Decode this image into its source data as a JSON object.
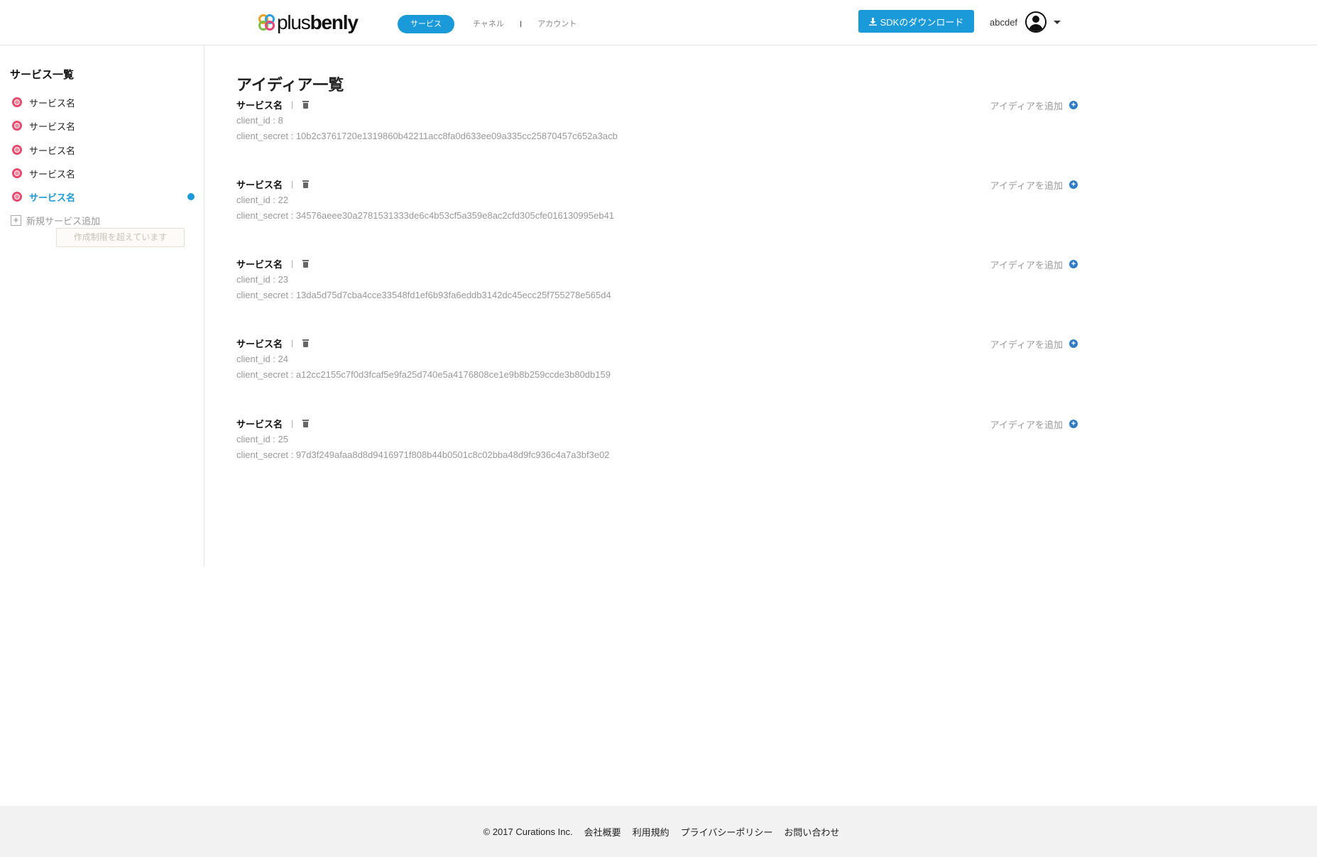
{
  "header": {
    "logo": {
      "light": "plus",
      "bold": "benly"
    },
    "nav": {
      "active": "サービス",
      "items": [
        "チャネル",
        "アカウント"
      ],
      "separator": "I"
    },
    "sdk_button": "SDKのダウンロード",
    "user_name": "abcdef"
  },
  "sidebar": {
    "title": "サービス一覧",
    "items": [
      {
        "label": "サービス名"
      },
      {
        "label": "サービス名"
      },
      {
        "label": "サービス名"
      },
      {
        "label": "サービス名"
      },
      {
        "label": "サービス名"
      }
    ],
    "add_label": "新規サービス追加",
    "limit_notice": "作成制限を超えています"
  },
  "main": {
    "title": "アイディア一覧",
    "add_idea_label": "アイディアを追加",
    "pipe": "|",
    "entries": [
      {
        "name": "サービス名",
        "client_id": "client_id : 8",
        "client_secret": "client_secret : 10b2c3761720e1319860b42211acc8fa0d633ee09a335cc25870457c652a3acb"
      },
      {
        "name": "サービス名",
        "client_id": "client_id : 22",
        "client_secret": "client_secret : 34576aeee30a2781531333de6c4b53cf5a359e8ac2cfd305cfe016130995eb41"
      },
      {
        "name": "サービス名",
        "client_id": "client_id : 23",
        "client_secret": "client_secret : 13da5d75d7cba4cce33548fd1ef6b93fa6eddb3142dc45ecc25f755278e565d4"
      },
      {
        "name": "サービス名",
        "client_id": "client_id : 24",
        "client_secret": "client_secret : a12cc2155c7f0d3fcaf5e9fa25d740e5a4176808ce1e9b8b259ccde3b80db159"
      },
      {
        "name": "サービス名",
        "client_id": "client_id : 25",
        "client_secret": "client_secret : 97d3f249afaa8d8d9416971f808b44b0501c8c02bba48d9fc936c4a7a3bf3e02"
      }
    ]
  },
  "footer": {
    "copyright": "© 2017 Curations Inc.",
    "links": [
      "会社概要",
      "利用規約",
      "プライバシーポリシー",
      "お問い合わせ"
    ]
  },
  "colors": {
    "accent": "#1a9ad8",
    "service_icon": "#e84a6e",
    "add_idea_icon": "#2f7bc4"
  },
  "icons": {
    "download": "download-icon",
    "trash": "trash-icon",
    "service": "service-icon",
    "plus": "plus-circle-icon"
  }
}
